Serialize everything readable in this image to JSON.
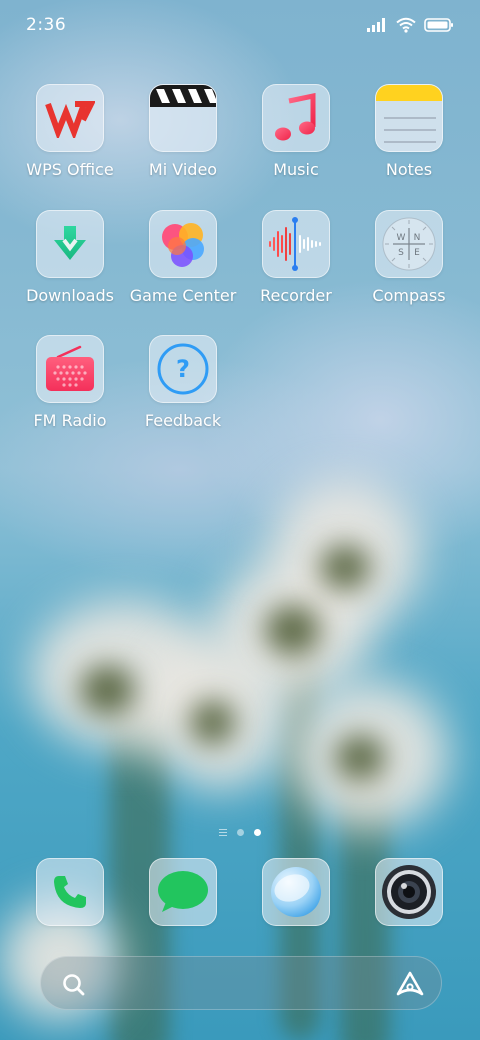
{
  "status_bar": {
    "time": "2:36",
    "icons": [
      "signal-icon",
      "wifi-icon",
      "battery-icon"
    ]
  },
  "home_apps": [
    {
      "label": "WPS Office",
      "icon": "wps-office-icon"
    },
    {
      "label": "Mi Video",
      "icon": "mi-video-icon"
    },
    {
      "label": "Music",
      "icon": "music-icon"
    },
    {
      "label": "Notes",
      "icon": "notes-icon"
    },
    {
      "label": "Downloads",
      "icon": "downloads-icon"
    },
    {
      "label": "Game Center",
      "icon": "game-center-icon"
    },
    {
      "label": "Recorder",
      "icon": "recorder-icon"
    },
    {
      "label": "Compass",
      "icon": "compass-icon"
    },
    {
      "label": "FM Radio",
      "icon": "fm-radio-icon"
    },
    {
      "label": "Feedback",
      "icon": "feedback-icon"
    }
  ],
  "compass_letters": {
    "n": "N",
    "e": "E",
    "s": "S",
    "w": "W"
  },
  "feedback_glyph": "?",
  "page_indicator": {
    "pages": 2,
    "active": 2
  },
  "dock": [
    "phone-icon",
    "messages-icon",
    "browser-icon",
    "camera-icon"
  ],
  "search_bar": {
    "left_icon": "search-icon",
    "right_icon": "assistant-icon"
  }
}
